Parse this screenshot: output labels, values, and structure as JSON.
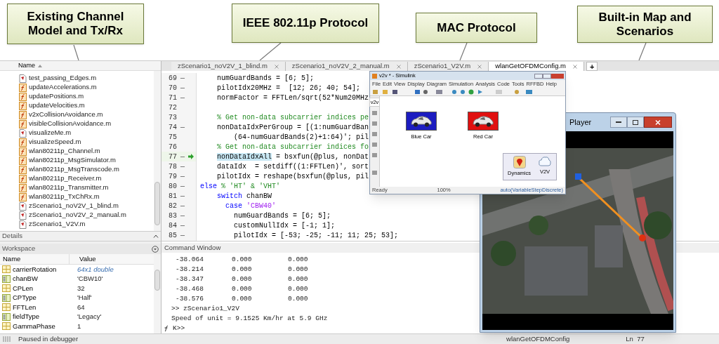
{
  "callouts": [
    {
      "text": "Existing Channel Model and Tx/Rx"
    },
    {
      "text": "IEEE 802.11p Protocol"
    },
    {
      "text": "MAC Protocol"
    },
    {
      "text": "Built-in Map and Scenarios"
    }
  ],
  "file_browser": {
    "column": "Name",
    "files": [
      {
        "name": "test_passing_Edges.m",
        "kind": "script"
      },
      {
        "name": "updateAccelerations.m",
        "kind": "function"
      },
      {
        "name": "updatePositions.m",
        "kind": "function"
      },
      {
        "name": "updateVelocities.m",
        "kind": "function"
      },
      {
        "name": "v2xCollisionAvoidance.m",
        "kind": "function"
      },
      {
        "name": "visibleCollisionAvoidance.m",
        "kind": "function"
      },
      {
        "name": "visualizeMe.m",
        "kind": "script"
      },
      {
        "name": "visualizeSpeed.m",
        "kind": "function"
      },
      {
        "name": "wlan80211p_Channel.m",
        "kind": "function"
      },
      {
        "name": "wlan80211p_MsgSimulator.m",
        "kind": "function"
      },
      {
        "name": "wlan80211p_MsgTranscode.m",
        "kind": "function"
      },
      {
        "name": "wlan80211p_Receiver.m",
        "kind": "function"
      },
      {
        "name": "wlan80211p_Transmitter.m",
        "kind": "function"
      },
      {
        "name": "wlan80211p_TxChRx.m",
        "kind": "function"
      },
      {
        "name": "zScenario1_noV2V_1_blind.m",
        "kind": "script"
      },
      {
        "name": "zScenario1_noV2V_2_manual.m",
        "kind": "script"
      },
      {
        "name": "zScenario1_V2V.m",
        "kind": "script"
      }
    ]
  },
  "details": {
    "title": "Details"
  },
  "workspace": {
    "title": "Workspace",
    "columns": [
      "Name",
      "Value"
    ],
    "variables": [
      {
        "name": "carrierRotation",
        "value": "64x1 double",
        "kind": "numeric",
        "summary": true
      },
      {
        "name": "chanBW",
        "value": "'CBW10'",
        "kind": "char",
        "summary": false
      },
      {
        "name": "CPLen",
        "value": "32",
        "kind": "numeric",
        "summary": false
      },
      {
        "name": "CPType",
        "value": "'Half'",
        "kind": "char",
        "summary": false
      },
      {
        "name": "FFTLen",
        "value": "64",
        "kind": "numeric",
        "summary": false
      },
      {
        "name": "fieldType",
        "value": "'Legacy'",
        "kind": "char",
        "summary": false
      },
      {
        "name": "GammaPhase",
        "value": "1",
        "kind": "numeric",
        "summary": false
      }
    ]
  },
  "editor": {
    "tabs": [
      {
        "label": "zScenario1_noV2V_1_blind.m",
        "selected": false
      },
      {
        "label": "zScenario1_noV2V_2_manual.m",
        "selected": false
      },
      {
        "label": "zScenario1_V2V.m",
        "selected": false
      },
      {
        "label": "wlanGetOFDMConfig.m",
        "selected": true
      }
    ],
    "new_tab": "+",
    "lines": [
      {
        "num": "69",
        "mark": "—",
        "current": false,
        "segments": [
          {
            "t": "    numGuardBands = [6; 5];",
            "kind": "code"
          }
        ]
      },
      {
        "num": "70",
        "mark": "—",
        "current": false,
        "segments": [
          {
            "t": "    pilotIdx20MHz =  [12; 26; 40; 54];",
            "kind": "code"
          }
        ]
      },
      {
        "num": "71",
        "mark": "—",
        "current": false,
        "segments": [
          {
            "t": "    normFactor = FFTLen/sqrt(52*Num20MHz",
            "kind": "code"
          }
        ]
      },
      {
        "num": "72",
        "current": false
      },
      {
        "num": "73",
        "current": false,
        "segments": [
          {
            "t": "    % Get non-data subcarrier indices pe",
            "kind": "comment"
          }
        ]
      },
      {
        "num": "74",
        "mark": "—",
        "current": false,
        "segments": [
          {
            "t": "    nonDataIdxPerGroup = [(1:numGuardBan",
            "kind": "code"
          }
        ]
      },
      {
        "num": "75",
        "current": false,
        "segments": [
          {
            "t": "        (64-numGuardBands(2)+1:64)'; pil",
            "kind": "code"
          }
        ]
      },
      {
        "num": "76",
        "current": false,
        "segments": [
          {
            "t": "    % Get non-data subcarrier indices fo",
            "kind": "comment"
          }
        ]
      },
      {
        "num": "77",
        "mark": "—",
        "current": true,
        "segments": [
          {
            "t": "    nonDataIdxAll",
            "kind": "highlight"
          },
          {
            "t": " = bsxfun(@plus, nonDat",
            "kind": "code"
          }
        ]
      },
      {
        "num": "78",
        "mark": "—",
        "current": false,
        "segments": [
          {
            "t": "    dataIdx  = setdiff((1:FFTLen)', sort",
            "kind": "code"
          }
        ]
      },
      {
        "num": "79",
        "mark": "—",
        "current": false,
        "segments": [
          {
            "t": "    pilotIdx = reshape(bsxfun(@plus, pil",
            "kind": "code"
          }
        ]
      },
      {
        "num": "80",
        "mark": "—",
        "current": false,
        "segments": [
          {
            "t": "else",
            "kind": "keyword"
          },
          {
            "t": " % 'HT' & 'VHT'",
            "kind": "comment"
          }
        ]
      },
      {
        "num": "81",
        "mark": "—",
        "current": false,
        "segments": [
          {
            "t": "    switch",
            "kind": "keyword"
          },
          {
            "t": " chanBW",
            "kind": "code"
          }
        ]
      },
      {
        "num": "82",
        "mark": "—",
        "current": false,
        "segments": [
          {
            "t": "      case",
            "kind": "keyword"
          },
          {
            "t": " 'CBW40'",
            "kind": "string"
          }
        ]
      },
      {
        "num": "83",
        "mark": "—",
        "current": false,
        "segments": [
          {
            "t": "        numGuardBands = [6; 5];",
            "kind": "code"
          }
        ]
      },
      {
        "num": "84",
        "mark": "—",
        "current": false,
        "segments": [
          {
            "t": "        customNullIdx = [-1; 1];",
            "kind": "code"
          }
        ]
      },
      {
        "num": "85",
        "mark": "—",
        "current": false,
        "segments": [
          {
            "t": "        pilotIdx = [-53; -25; -11; 11; 25; 53];",
            "kind": "code"
          }
        ]
      }
    ]
  },
  "command_window": {
    "title": "Command Window",
    "rows": [
      [
        "-38.064",
        "0.000",
        "0.000"
      ],
      [
        "-38.214",
        "0.000",
        "0.000"
      ],
      [
        "-38.347",
        "0.000",
        "0.000"
      ],
      [
        "-38.468",
        "0.000",
        "0.000"
      ],
      [
        "-38.576",
        "0.000",
        "0.000"
      ]
    ],
    "command": ">> zScenario1_V2V",
    "output": "Speed of unit = 9.1525 Km/hr at 5.9 GHz",
    "prompt": "K>>"
  },
  "simulink": {
    "title": "v2v * - Simulink",
    "menu": [
      "File",
      "Edit",
      "View",
      "Display",
      "Diagram",
      "Simulation",
      "Analysis",
      "Code",
      "Tools",
      "RFFBD",
      "Help"
    ],
    "model_tab": "v2v",
    "blocks": [
      {
        "label": "Blue Car",
        "color": "#1c1cc0"
      },
      {
        "label": "Red Car",
        "color": "#e01010"
      }
    ],
    "subsystems": [
      {
        "label": "Dynamics",
        "kind": "map"
      },
      {
        "label": "V2V",
        "kind": "cloud"
      }
    ],
    "status": [
      "Ready",
      "100%",
      "auto(VariableStepDiscrete)"
    ]
  },
  "player": {
    "title": "Player"
  },
  "status_bar": {
    "text": "Paused in debugger",
    "file": "wlanGetOFDMConfig",
    "position": "Ln  77"
  }
}
